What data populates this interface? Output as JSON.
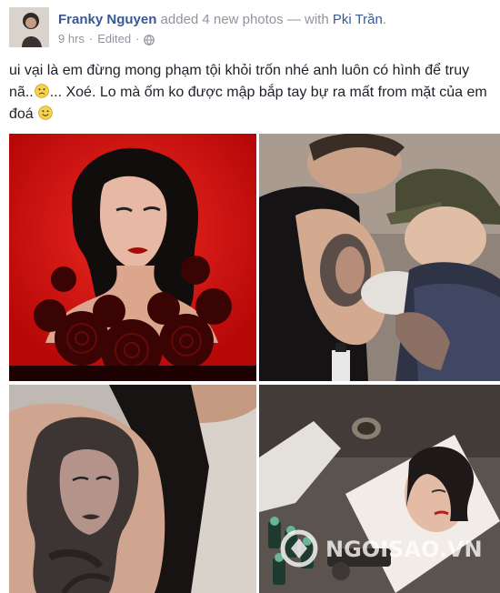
{
  "post": {
    "author": "Franky Nguyen",
    "action": " added 4 new photos — with ",
    "tagged": "Pki Trần",
    "tagged_suffix": ".",
    "time": "9 hrs",
    "separator": "·",
    "edited": "Edited",
    "caption": "ui vại là em đừng mong phạm tội khỏi trốn nhé anh luôn có hình để truy nã..",
    "caption_2": "... Xoé. Lo mà ốm ko được mập bắp tay bự ra mất from mặt của em đoá"
  },
  "photos": [
    {
      "icon": "portrait-artwork"
    },
    {
      "icon": "tattoo-session"
    },
    {
      "icon": "arm-tattoo"
    },
    {
      "icon": "tattoo-reference"
    }
  ],
  "watermark": {
    "text": "NGOISAO.VN"
  },
  "colors": {
    "link": "#365899",
    "muted": "#90949c",
    "text": "#1d2129",
    "red_bg": "#d80f0f"
  }
}
